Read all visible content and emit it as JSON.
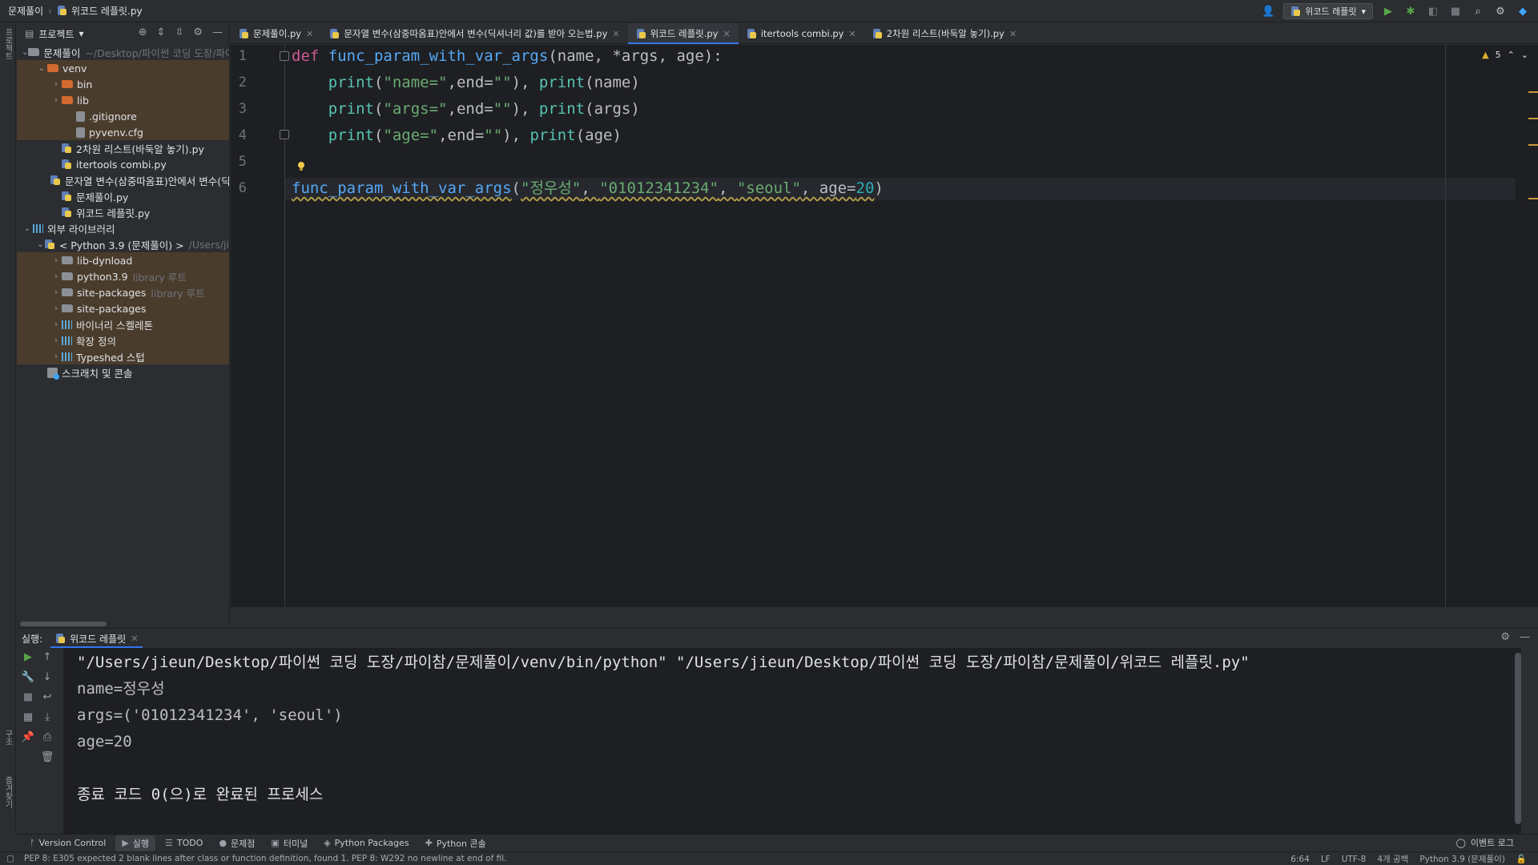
{
  "titlebar": {
    "project": "문제풀이",
    "file": "위코드 레플릿.py",
    "run_config": "위코드 레플릿"
  },
  "leftstrip": {
    "top": "프로젝트",
    "middle": "구조",
    "bottom": "즐겨찾기"
  },
  "project_panel": {
    "title": "프로젝트",
    "items": [
      {
        "label": "문제풀이",
        "dim": "~/Desktop/파이썬 코딩 도장/파이",
        "indent": 0,
        "arrow": "open",
        "icon": "folder"
      },
      {
        "label": "venv",
        "dim": "",
        "indent": 1,
        "arrow": "open",
        "icon": "folder-orange"
      },
      {
        "label": "bin",
        "dim": "",
        "indent": 2,
        "arrow": "closed",
        "icon": "folder-orange"
      },
      {
        "label": "lib",
        "dim": "",
        "indent": 2,
        "arrow": "closed",
        "icon": "folder-orange"
      },
      {
        "label": ".gitignore",
        "dim": "",
        "indent": 3,
        "arrow": "none",
        "icon": "file"
      },
      {
        "label": "pyvenv.cfg",
        "dim": "",
        "indent": 3,
        "arrow": "none",
        "icon": "file"
      },
      {
        "label": "2차원 리스트(바둑알 놓기).py",
        "dim": "",
        "indent": 2,
        "arrow": "none",
        "icon": "py"
      },
      {
        "label": "itertools combi.py",
        "dim": "",
        "indent": 2,
        "arrow": "none",
        "icon": "py"
      },
      {
        "label": "문자열 변수(삼중따옴표)안에서 변수(딕셔",
        "dim": "",
        "indent": 2,
        "arrow": "none",
        "icon": "py"
      },
      {
        "label": "문제풀이.py",
        "dim": "",
        "indent": 2,
        "arrow": "none",
        "icon": "py"
      },
      {
        "label": "위코드 레플릿.py",
        "dim": "",
        "indent": 2,
        "arrow": "none",
        "icon": "py"
      },
      {
        "label": "외부 라이브러리",
        "dim": "",
        "indent": 0,
        "arrow": "open",
        "icon": "lib"
      },
      {
        "label": "< Python 3.9 (문제풀이) >",
        "dim": "/Users/ji",
        "indent": 1,
        "arrow": "open",
        "icon": "py"
      },
      {
        "label": "lib-dynload",
        "dim": "",
        "indent": 2,
        "arrow": "closed",
        "icon": "folder"
      },
      {
        "label": "python3.9",
        "dim": "library 루트",
        "indent": 2,
        "arrow": "closed",
        "icon": "folder"
      },
      {
        "label": "site-packages",
        "dim": "library 루트",
        "indent": 2,
        "arrow": "closed",
        "icon": "folder"
      },
      {
        "label": "site-packages",
        "dim": "",
        "indent": 2,
        "arrow": "closed",
        "icon": "folder"
      },
      {
        "label": "바이너리 스켈레톤",
        "dim": "",
        "indent": 2,
        "arrow": "closed",
        "icon": "lib"
      },
      {
        "label": "확장 정의",
        "dim": "",
        "indent": 2,
        "arrow": "closed",
        "icon": "lib"
      },
      {
        "label": "Typeshed 스텁",
        "dim": "",
        "indent": 2,
        "arrow": "closed",
        "icon": "lib"
      },
      {
        "label": "스크래치 및 콘솔",
        "dim": "",
        "indent": 1,
        "arrow": "none",
        "icon": "scratch"
      }
    ]
  },
  "tabs": [
    {
      "label": "문제풀이.py",
      "active": false
    },
    {
      "label": "문자열 변수(삼중따옴표)안에서 변수(딕셔너리 값)를 받아 오는법.py",
      "active": false
    },
    {
      "label": "위코드 레플릿.py",
      "active": true
    },
    {
      "label": "itertools combi.py",
      "active": false
    },
    {
      "label": "2차원 리스트(바둑알 놓기).py",
      "active": false
    }
  ],
  "editor": {
    "warning_count": "5",
    "line_numbers": [
      "1",
      "2",
      "3",
      "4",
      "5",
      "6"
    ],
    "lines": [
      [
        {
          "t": "def ",
          "c": "kw"
        },
        {
          "t": "func_param_with_var_args",
          "c": "fn"
        },
        {
          "t": "(name, ",
          "c": "par"
        },
        {
          "t": "*args",
          "c": "par"
        },
        {
          "t": ", age):",
          "c": "par"
        }
      ],
      [
        {
          "t": "    ",
          "c": "par"
        },
        {
          "t": "print",
          "c": "bi"
        },
        {
          "t": "(",
          "c": "par"
        },
        {
          "t": "\"name=\"",
          "c": "str"
        },
        {
          "t": ",end=",
          "c": "par"
        },
        {
          "t": "\"\"",
          "c": "str"
        },
        {
          "t": "), ",
          "c": "par"
        },
        {
          "t": "print",
          "c": "bi"
        },
        {
          "t": "(name)",
          "c": "par"
        }
      ],
      [
        {
          "t": "    ",
          "c": "par"
        },
        {
          "t": "print",
          "c": "bi"
        },
        {
          "t": "(",
          "c": "par"
        },
        {
          "t": "\"args=\"",
          "c": "str"
        },
        {
          "t": ",end=",
          "c": "par"
        },
        {
          "t": "\"\"",
          "c": "str"
        },
        {
          "t": "), ",
          "c": "par"
        },
        {
          "t": "print",
          "c": "bi"
        },
        {
          "t": "(args)",
          "c": "par"
        }
      ],
      [
        {
          "t": "    ",
          "c": "par"
        },
        {
          "t": "print",
          "c": "bi"
        },
        {
          "t": "(",
          "c": "par"
        },
        {
          "t": "\"age=\"",
          "c": "str"
        },
        {
          "t": ",end=",
          "c": "par"
        },
        {
          "t": "\"\"",
          "c": "str"
        },
        {
          "t": "), ",
          "c": "par"
        },
        {
          "t": "print",
          "c": "bi"
        },
        {
          "t": "(age)",
          "c": "par"
        }
      ],
      [],
      [
        {
          "t": "func_param_with_var_args",
          "c": "fn warn-underline"
        },
        {
          "t": "(",
          "c": "par"
        },
        {
          "t": "\"정우성\"",
          "c": "str warn-underline"
        },
        {
          "t": ", ",
          "c": "par warn-underline"
        },
        {
          "t": "\"01012341234\"",
          "c": "str warn-underline"
        },
        {
          "t": ", ",
          "c": "par warn-underline"
        },
        {
          "t": "\"seoul\"",
          "c": "str warn-underline"
        },
        {
          "t": ", age=",
          "c": "par warn-underline"
        },
        {
          "t": "20",
          "c": "num warn-underline"
        },
        {
          "t": ")",
          "c": "par"
        }
      ]
    ]
  },
  "run_panel": {
    "label": "실행:",
    "tab": "위코드 레플릿",
    "console": [
      {
        "text": "\"/Users/jieun/Desktop/파이썬 코딩 도장/파이참/문제풀이/venv/bin/python\" \"/Users/jieun/Desktop/파이썬 코딩 도장/파이참/문제풀이/위코드 레플릿.py\"",
        "cls": "cmd"
      },
      {
        "text": "name=정우성",
        "cls": ""
      },
      {
        "text": "args=('01012341234', 'seoul')",
        "cls": ""
      },
      {
        "text": "age=20",
        "cls": ""
      },
      {
        "text": "",
        "cls": ""
      },
      {
        "text": "종료 코드 0(으)로 완료된 프로세스",
        "cls": "exit"
      }
    ]
  },
  "bottom_tools": [
    {
      "label": "Version Control",
      "icon": "branch-icon",
      "glyph": "ᚠ",
      "active": false
    },
    {
      "label": "실행",
      "icon": "run-icon",
      "glyph": "▶",
      "active": true
    },
    {
      "label": "TODO",
      "icon": "list-icon",
      "glyph": "☰",
      "active": false
    },
    {
      "label": "문제점",
      "icon": "problems-icon",
      "glyph": "●",
      "active": false
    },
    {
      "label": "터미널",
      "icon": "terminal-icon",
      "glyph": "▣",
      "active": false
    },
    {
      "label": "Python Packages",
      "icon": "packages-icon",
      "glyph": "◈",
      "active": false
    },
    {
      "label": "Python 콘솔",
      "icon": "python-console-icon",
      "glyph": "✚",
      "active": false
    }
  ],
  "event_log": "이벤트 로그",
  "status": {
    "message": "PEP 8: E305 expected 2 blank lines after class or function definition, found 1. PEP 8: W292 no newline at end of fil.",
    "position": "6:64",
    "line_sep": "LF",
    "encoding": "UTF-8",
    "indent": "4개 공백",
    "interpreter": "Python 3.9 (문제풀이)"
  }
}
